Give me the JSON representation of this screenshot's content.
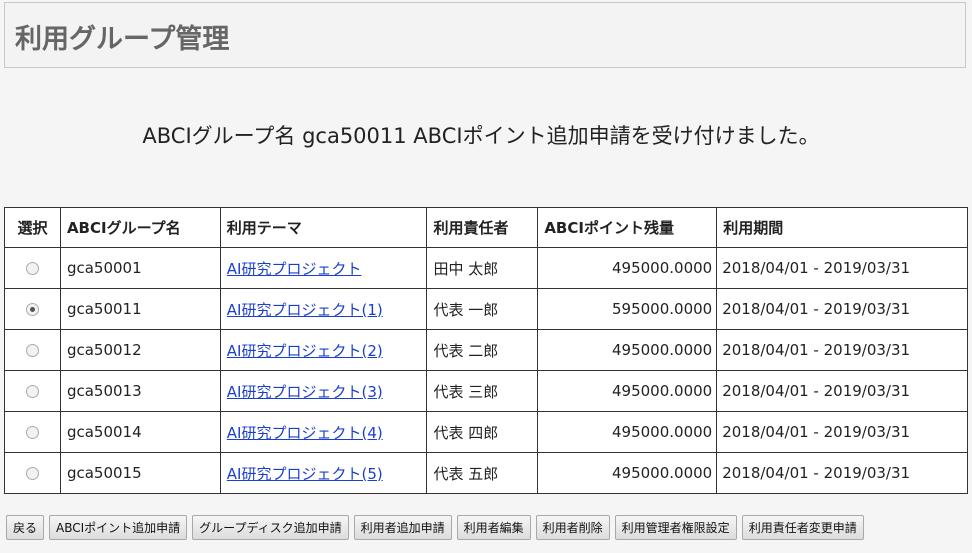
{
  "header": {
    "title": "利用グループ管理"
  },
  "message": "ABCIグループ名 gca50011 ABCIポイント追加申請を受け付けました。",
  "table": {
    "columns": {
      "select": "選択",
      "group": "ABCIグループ名",
      "theme": "利用テーマ",
      "owner": "利用責任者",
      "points": "ABCIポイント残量",
      "period": "利用期間"
    },
    "rows": [
      {
        "selected": false,
        "group": "gca50001",
        "theme": "AI研究プロジェクト",
        "owner": "田中 太郎",
        "points": "495000.0000",
        "period": "2018/04/01 - 2019/03/31"
      },
      {
        "selected": true,
        "group": "gca50011",
        "theme": "AI研究プロジェクト(1)",
        "owner": "代表 一郎",
        "points": "595000.0000",
        "period": "2018/04/01 - 2019/03/31"
      },
      {
        "selected": false,
        "group": "gca50012",
        "theme": "AI研究プロジェクト(2)",
        "owner": "代表 二郎",
        "points": "495000.0000",
        "period": "2018/04/01 - 2019/03/31"
      },
      {
        "selected": false,
        "group": "gca50013",
        "theme": "AI研究プロジェクト(3)",
        "owner": "代表 三郎",
        "points": "495000.0000",
        "period": "2018/04/01 - 2019/03/31"
      },
      {
        "selected": false,
        "group": "gca50014",
        "theme": "AI研究プロジェクト(4)",
        "owner": "代表 四郎",
        "points": "495000.0000",
        "period": "2018/04/01 - 2019/03/31"
      },
      {
        "selected": false,
        "group": "gca50015",
        "theme": "AI研究プロジェクト(5)",
        "owner": "代表 五郎",
        "points": "495000.0000",
        "period": "2018/04/01 - 2019/03/31"
      }
    ]
  },
  "buttons": {
    "back": "戻る",
    "add_points": "ABCIポイント追加申請",
    "add_disk": "グループディスク追加申請",
    "add_user": "利用者追加申請",
    "edit_user": "利用者編集",
    "delete_user": "利用者削除",
    "admin_rights": "利用管理者権限設定",
    "change_owner": "利用責任者変更申請"
  },
  "colors": {
    "link": "#1a3fd0",
    "title": "#666666"
  }
}
